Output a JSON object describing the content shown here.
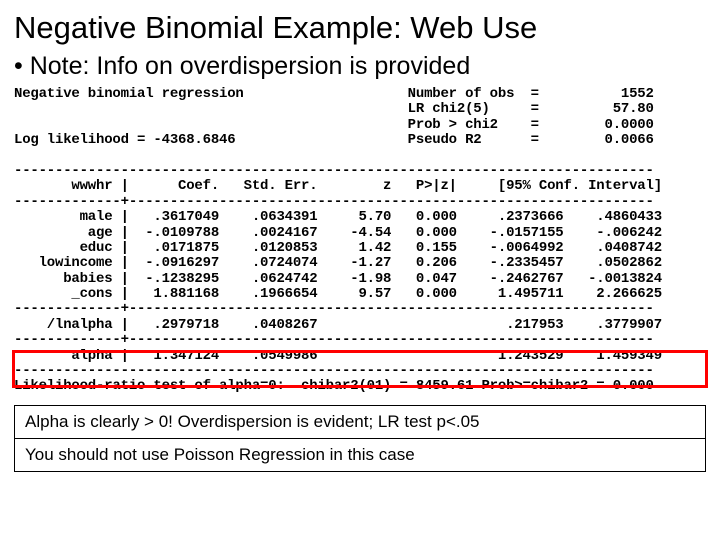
{
  "title": "Negative Binomial Example:  Web Use",
  "bullet": "Note:  Info on overdispersion is provided",
  "stata": {
    "header_left1": "Negative binomial regression",
    "header_left2": "Log likelihood = -4368.6846",
    "stats": {
      "nobs_label": "Number of obs",
      "nobs": "1552",
      "lrchi_label": "LR chi2(5)",
      "lrchi": "57.80",
      "prob_label": "Prob > chi2",
      "prob": "0.0000",
      "pseudo_label": "Pseudo R2",
      "pseudo": "0.0066"
    },
    "depvar": "wwwhr",
    "cols": {
      "c1": "Coef.",
      "c2": "Std. Err.",
      "c3": "z",
      "c4": "P>|z|",
      "c5": "[95% Conf. Interval]"
    },
    "rows": [
      {
        "var": "male",
        "coef": ".3617049",
        "se": ".0634391",
        "z": "5.70",
        "p": "0.000",
        "lo": ".2373666",
        "hi": ".4860433"
      },
      {
        "var": "age",
        "coef": "-.0109788",
        "se": ".0024167",
        "z": "-4.54",
        "p": "0.000",
        "lo": "-.0157155",
        "hi": "-.006242"
      },
      {
        "var": "educ",
        "coef": ".0171875",
        "se": ".0120853",
        "z": "1.42",
        "p": "0.155",
        "lo": "-.0064992",
        "hi": ".0408742"
      },
      {
        "var": "lowincome",
        "coef": "-.0916297",
        "se": ".0724074",
        "z": "-1.27",
        "p": "0.206",
        "lo": "-.2335457",
        "hi": ".0502862"
      },
      {
        "var": "babies",
        "coef": "-.1238295",
        "se": ".0624742",
        "z": "-1.98",
        "p": "0.047",
        "lo": "-.2462767",
        "hi": "-.0013824"
      },
      {
        "var": "_cons",
        "coef": "1.881168",
        "se": ".1966654",
        "z": "9.57",
        "p": "0.000",
        "lo": "1.495711",
        "hi": "2.266625"
      }
    ],
    "lnalpha": {
      "var": "/lnalpha",
      "coef": ".2979718",
      "se": ".0408267",
      "lo": ".217953",
      "hi": ".3779907"
    },
    "alpha": {
      "var": "alpha",
      "coef": "1.347124",
      "se": ".0549986",
      "lo": "1.243529",
      "hi": "1.459349"
    },
    "lrtest": "Likelihood-ratio test of alpha=0:  chibar2(01) = 8459.61 Prob>=chibar2 = 0.000"
  },
  "note1": "Alpha is clearly > 0!  Overdispersion is evident;  LR test p<.05",
  "note2": "You should not use Poisson Regression in this case"
}
